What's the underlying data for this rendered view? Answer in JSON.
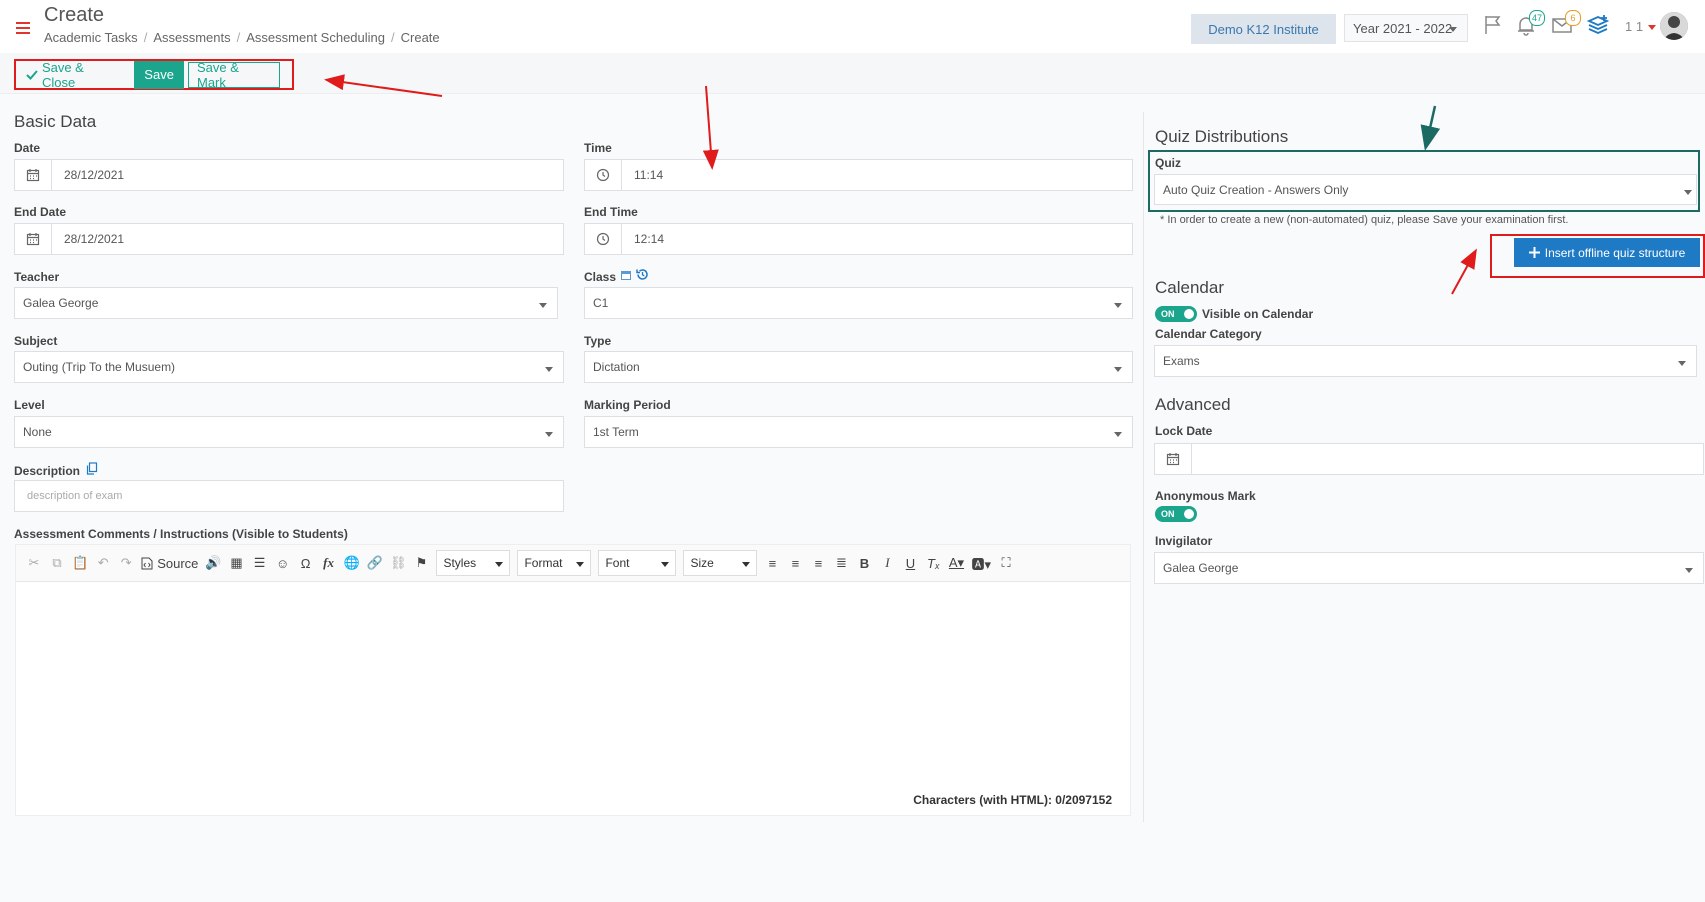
{
  "header": {
    "title": "Create",
    "breadcrumbs": [
      "Academic Tasks",
      "Assessments",
      "Assessment Scheduling",
      "Create"
    ],
    "institute": "Demo K12 Institute",
    "year": "Year 2021 - 2022",
    "notifications_count": "47",
    "messages_count": "6",
    "user_number": "1 1"
  },
  "actions": {
    "save_close": "Save & Close",
    "save": "Save",
    "save_mark": "Save & Mark"
  },
  "basic": {
    "title": "Basic Data",
    "date_label": "Date",
    "date": "28/12/2021",
    "time_label": "Time",
    "time": "11:14",
    "end_date_label": "End Date",
    "end_date": "28/12/2021",
    "end_time_label": "End Time",
    "end_time": "12:14",
    "teacher_label": "Teacher",
    "teacher": "Galea George",
    "class_label": "Class",
    "class": "C1",
    "subject_label": "Subject",
    "subject": "Outing (Trip To the Musuem)",
    "type_label": "Type",
    "type": "Dictation",
    "level_label": "Level",
    "level": "None",
    "marking_label": "Marking Period",
    "marking": "1st Term",
    "description_label": "Description",
    "description_placeholder": "description of exam",
    "comments_label": "Assessment Comments / Instructions (Visible to Students)"
  },
  "editor": {
    "source": "Source",
    "styles": "Styles",
    "format": "Format",
    "font": "Font",
    "size": "Size",
    "chars": "Characters (with HTML): 0/2097152"
  },
  "quiz": {
    "title": "Quiz Distributions",
    "label": "Quiz",
    "value": "Auto Quiz Creation - Answers Only",
    "note": "* In order to create a new (non-automated) quiz, please Save your examination first.",
    "insert_button": "Insert offline quiz structure"
  },
  "calendar": {
    "title": "Calendar",
    "toggle": "ON",
    "visible_label": "Visible on Calendar",
    "category_label": "Calendar Category",
    "category": "Exams"
  },
  "advanced": {
    "title": "Advanced",
    "lock_label": "Lock Date",
    "anon_label": "Anonymous Mark",
    "anon_toggle": "ON",
    "invigilator_label": "Invigilator",
    "invigilator": "Galea George"
  },
  "colors": {
    "accent": "#1ba58c",
    "primary_button": "#1f7ac6",
    "highlight_red": "#e01b1b",
    "highlight_teal": "#1c6a64"
  }
}
